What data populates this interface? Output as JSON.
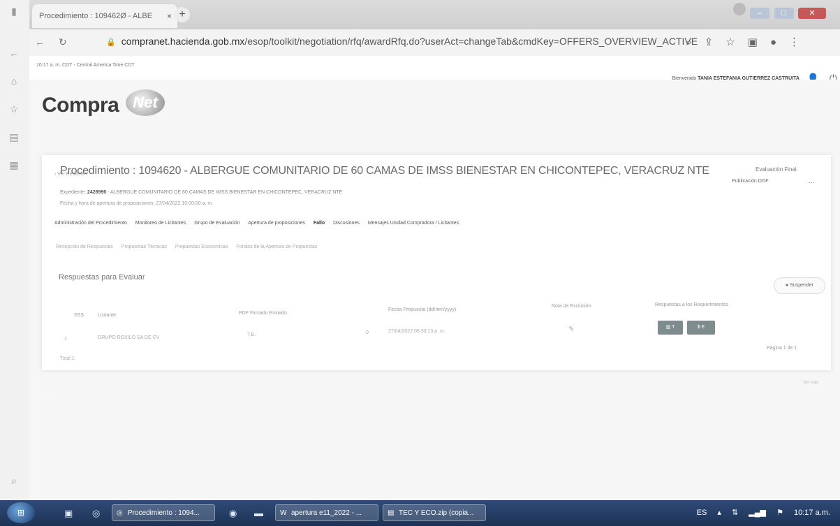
{
  "browser": {
    "tab_title": "Procedimiento : 109462Ø - ALBE",
    "tab_close": "×",
    "new_tab": "+",
    "url_host": "compranet.hacienda.gob.mx",
    "url_path": "/esop/toolkit/negotiation/rfq/awardRfq.do?userAct=changeTab&cmdKey=OFFERS_OVERVIEW_ACTIVE",
    "icons": [
      "back-icon",
      "reload-icon",
      "lock-icon",
      "zoom-icon",
      "share-icon",
      "star-icon",
      "sidepanel-icon",
      "profile-icon",
      "menu-icon"
    ]
  },
  "infobar": {
    "timezone": "10:17 a. m. CDT - Central America Time CDT",
    "welcome_prefix": "Bienvenido",
    "welcome_name": "TANIA ESTEFANIA GUTIERREZ CASTRUITA"
  },
  "brand": {
    "text": "Compra",
    "globe_text": "Net"
  },
  "page": {
    "breadcrumb": "‹  Ver Resumen",
    "pub_button": "Publicación DOF",
    "more_button": "···",
    "eval_link": "Evaluación Final",
    "title": "Procedimiento : 1094620 - ALBERGUE COMUNITARIO DE 60 CAMAS DE IMSS BIENESTAR EN CHICONTEPEC, VERACRUZ NTE",
    "expediente_label": "Expediente: ",
    "expediente_number": "2428996",
    "expediente_text": " - ALBERGUE COMUNITARIO DE 60 CAMAS DE IMSS BIENESTAR EN CHICONTEPEC, VERACRUZ NTE",
    "fecha_apertura": "Fecha y hora de apertura de proposiciones: 27/04/2022 10:00:00 a. m.",
    "tabs": [
      "Administración del Procedimiento",
      "Monitoreo de Licitantes",
      "Grupo de Evaluación",
      "Apertura de proposiciones",
      "Fallo",
      "Discusiones",
      "Mensajes Unidad Compradora / Licitantes"
    ],
    "subtabs": [
      "Recepción de Respuestas",
      "Propuestas Técnicas",
      "Propuestas Económicas",
      "Fondos de la Apertura de Propuestas"
    ],
    "section_title": "Respuestas para Evaluar",
    "suspend_button": "Suspender",
    "table": {
      "headers": [
        "SSS",
        "Licitante",
        "PDF Firmado Enviado",
        "Fecha Propuesta (dd/mm/yyyy)",
        "Nota de Exclusión",
        "Respuestas a los Requerimientos"
      ],
      "row": {
        "index": "1",
        "licitante": "GRUPO ROXILO SA DE CV",
        "pdf": "T.E.",
        "count": "0",
        "fecha": "27/04/2022 08:33:13 a. m.",
        "nota_icon": "edit-icon",
        "btn_t": "T",
        "btn_e": "E"
      }
    },
    "pagina": "Página 1 de 1",
    "total": "Total 1",
    "ver_mas": "Ver más",
    "footer_dots": "· · ·"
  },
  "taskbar": {
    "items": [
      "Procedimiento : 1094...",
      "apertura e11_2022 - ...",
      "TEC Y ECO.zip (copia..."
    ],
    "lang": "ES",
    "clock": "10:17 a.m."
  }
}
